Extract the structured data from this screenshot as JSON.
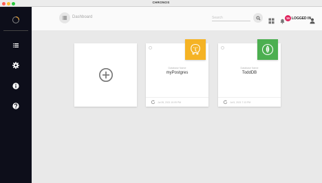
{
  "window": {
    "title": "CHRONOS"
  },
  "header": {
    "breadcrumb": "Dashboard",
    "search_placeholder": "Search",
    "notification_count": "15",
    "user_label": "LOGGED IN"
  },
  "sidebar": {
    "items": [
      {
        "name": "list",
        "icon": "list-icon"
      },
      {
        "name": "settings",
        "icon": "gear-icon"
      },
      {
        "name": "info",
        "icon": "info-icon"
      },
      {
        "name": "help",
        "icon": "help-icon"
      }
    ]
  },
  "databases": [
    {
      "label": "Database Name",
      "name": "myPostgres",
      "type": "postgresql",
      "color": "#f5b324",
      "updated": "Jul 28, 2021 10:09 PM"
    },
    {
      "label": "Database Name",
      "name": "ToddDB",
      "type": "mongodb",
      "color": "#4caf50",
      "updated": "Jul 5, 2021 7:13 PM"
    }
  ],
  "colors": {
    "sidebar": "#0d0e1a",
    "accent_orange": "#e8a33d",
    "badge": "#e0245e"
  }
}
